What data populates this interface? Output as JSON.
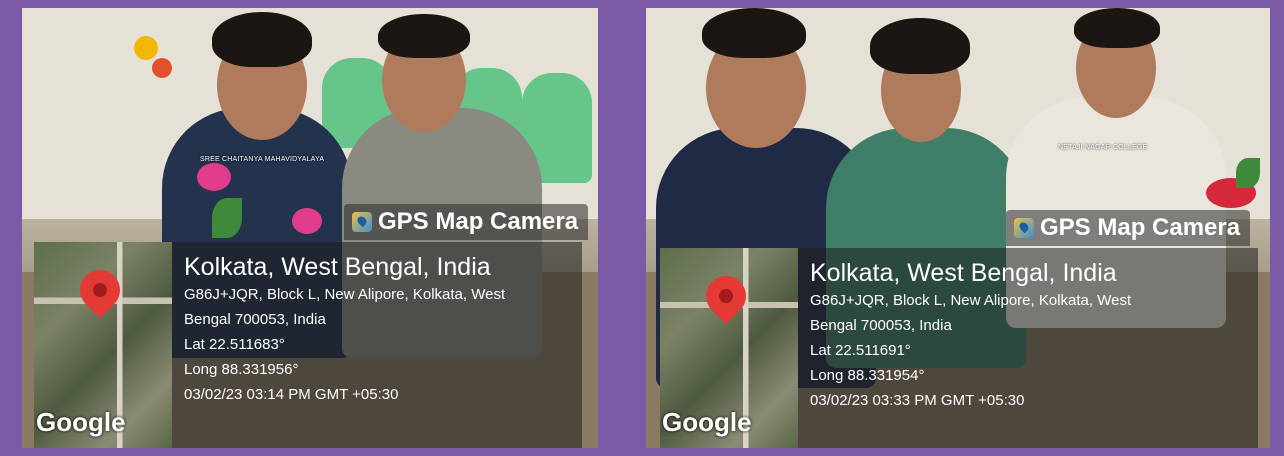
{
  "photos": [
    {
      "college_label": "SREE CHAITANYA MAHAVIDYALAYA",
      "overlay": {
        "app_name": "GPS Map Camera",
        "map_brand": "Google",
        "location_title": "Kolkata, West Bengal, India",
        "address_line1": "G86J+JQR, Block L, New Alipore, Kolkata, West",
        "address_line2": "Bengal 700053, India",
        "lat": "Lat 22.511683°",
        "long": "Long 88.331956°",
        "datetime": "03/02/23 03:14 PM GMT +05:30"
      }
    },
    {
      "college_label": "NETAJI NAGAR COLLEGE",
      "overlay": {
        "app_name": "GPS Map Camera",
        "map_brand": "Google",
        "location_title": "Kolkata, West Bengal, India",
        "address_line1": "G86J+JQR, Block L, New Alipore, Kolkata, West",
        "address_line2": "Bengal 700053, India",
        "lat": "Lat 22.511691°",
        "long": "Long 88.331954°",
        "datetime": "03/02/23 03:33 PM GMT +05:30"
      }
    }
  ],
  "colors": {
    "background": "#7b5aa6",
    "pin": "#e53935",
    "chair": "#4fc07a"
  },
  "icons": [
    "gps-map-camera-icon",
    "map-pin-icon"
  ]
}
